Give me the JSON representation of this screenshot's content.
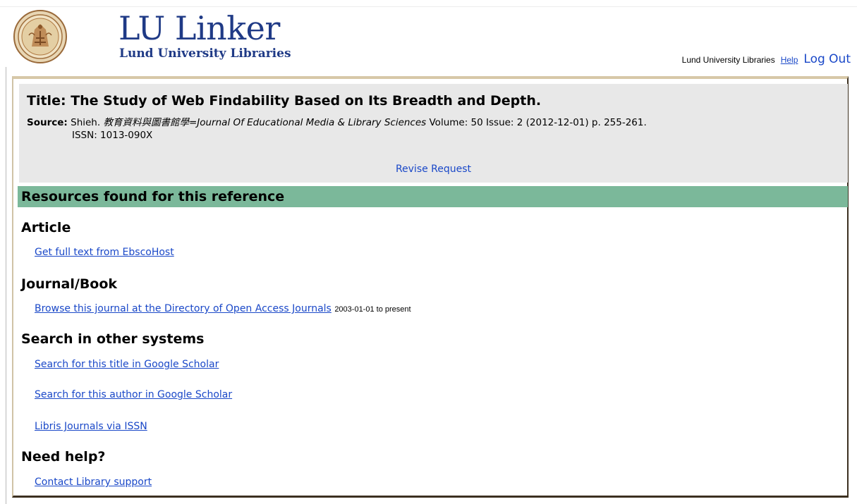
{
  "header": {
    "logo_title": "LU Linker",
    "logo_subtitle": "Lund University Libraries",
    "institution": "Lund University Libraries",
    "help_label": "Help",
    "logout_label": "Log Out"
  },
  "citation": {
    "title_label": "Title:",
    "title": "The Study of Web Findability Based on Its Breadth and Depth.",
    "source_label": "Source:",
    "author": "Shieh.",
    "journal": "教育資料與圖書館學=Journal Of Educational Media & Library Sciences",
    "details": "Volume: 50 Issue: 2 (2012-12-01) p. 255-261.",
    "issn": "ISSN: 1013-090X",
    "revise_label": "Revise Request"
  },
  "resources": {
    "heading": "Resources found for this reference"
  },
  "sections": {
    "article": {
      "heading": "Article",
      "links": [
        "Get full text from EbscoHost"
      ]
    },
    "journal_book": {
      "heading": "Journal/Book",
      "links": [
        "Browse this journal at the Directory of Open Access Journals"
      ],
      "coverage": "2003-01-01 to present"
    },
    "other_systems": {
      "heading": "Search in other systems",
      "links": [
        "Search for this title in Google Scholar",
        "Search for this author in Google Scholar",
        "Libris Journals via ISSN"
      ]
    },
    "help": {
      "heading": "Need help?",
      "links": [
        "Contact Library support"
      ]
    }
  },
  "colors": {
    "brand": "#1f3a86",
    "link": "#1a48c8",
    "resources_bar": "#7bb89a",
    "citation_bg": "#e8e8e8"
  }
}
